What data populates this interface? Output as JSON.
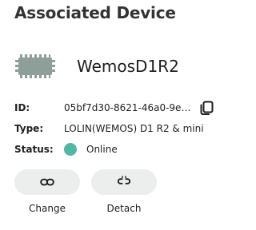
{
  "heading": "Associated Device",
  "device": {
    "name": "WemosD1R2",
    "icon": "microcontroller-board-icon"
  },
  "details": {
    "id_label": "ID:",
    "id_value": "05bf7d30-8621-46a0-9e45-...",
    "type_label": "Type:",
    "type_value": "LOLIN(WEMOS) D1 R2 & mini",
    "status_label": "Status:",
    "status_value": "Online",
    "status_color": "#4fb9a3",
    "copy_icon": "copy-icon"
  },
  "actions": {
    "change_label": "Change",
    "change_icon": "link-icon",
    "detach_label": "Detach",
    "detach_icon": "unlink-icon"
  }
}
